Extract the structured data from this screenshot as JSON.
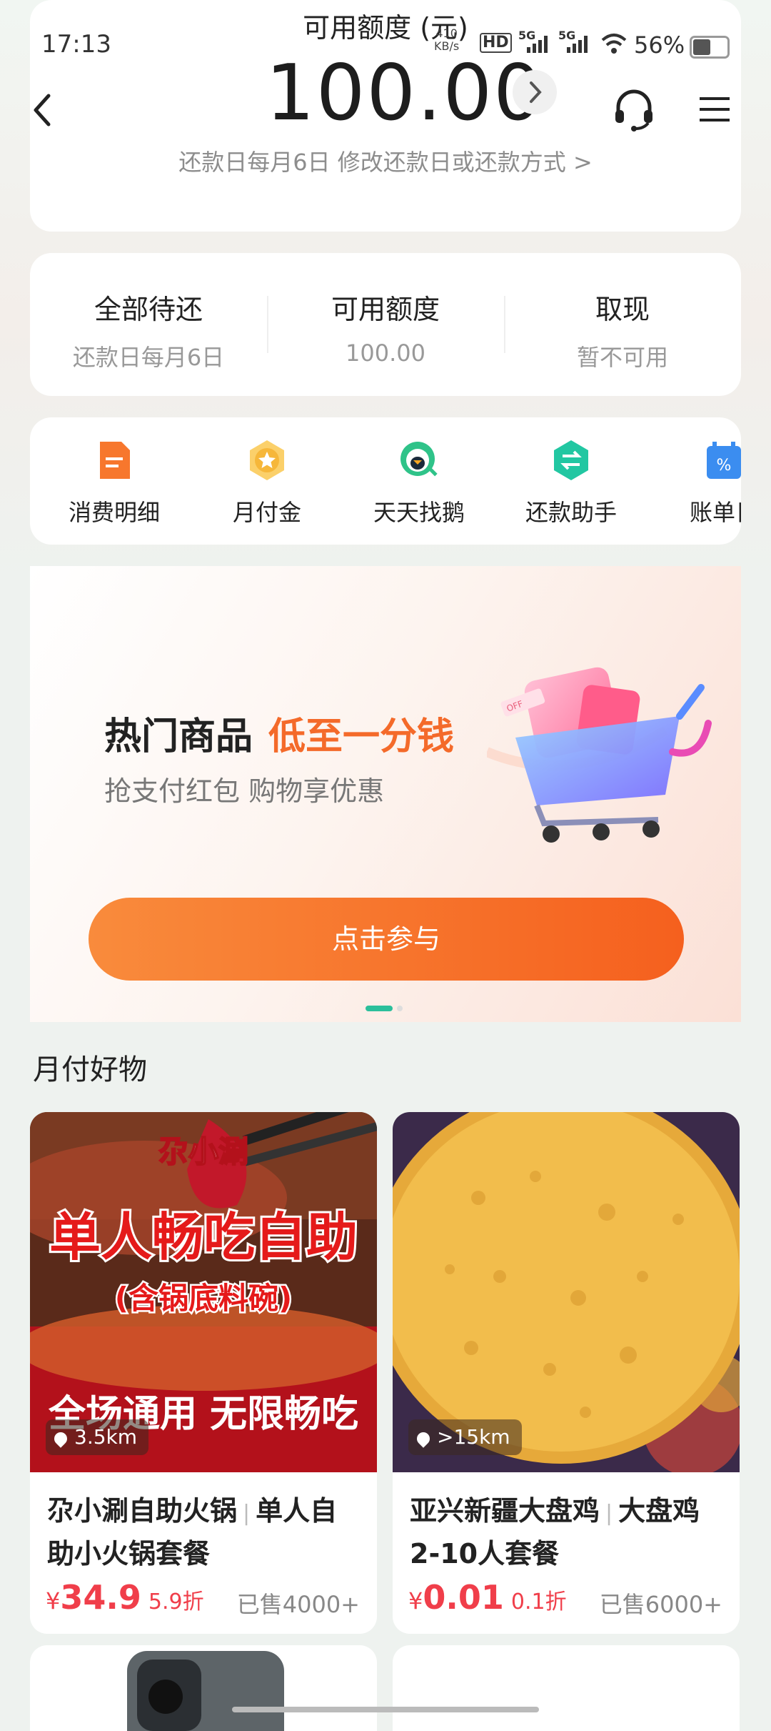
{
  "status_bar": {
    "time": "17:13",
    "net_speed_value": "410",
    "net_speed_unit": "KB/s",
    "hd_label": "HD",
    "net1": "5G",
    "net2": "5G",
    "battery": "56%"
  },
  "header": {
    "available_label": "可用额度 (元)",
    "amount": "100.00",
    "repay_info": "还款日每月6日 修改还款日或还款方式 >"
  },
  "summary": [
    {
      "title": "全部待还",
      "value": "还款日每月6日"
    },
    {
      "title": "可用额度",
      "value": "100.00"
    },
    {
      "title": "取现",
      "value": "暂不可用"
    }
  ],
  "quick_nav": [
    {
      "label": "消费明细",
      "icon": "bill-detail-icon",
      "color": "#f7772d"
    },
    {
      "label": "月付金",
      "icon": "star-coin-icon",
      "color": "#f6b73a"
    },
    {
      "label": "天天找鹅",
      "icon": "penguin-icon",
      "color": "#2fc389"
    },
    {
      "label": "还款助手",
      "icon": "repay-assistant-icon",
      "color": "#22c7a2"
    },
    {
      "label": "账单日",
      "icon": "calendar-icon",
      "color": "#3b8df0"
    }
  ],
  "banner": {
    "title": "热门商品",
    "highlight": "低至一分钱",
    "subtitle": "抢支付红包 购物享优惠",
    "button": "点击参与",
    "cart_tag": "OFF",
    "accent": "#f46a2a"
  },
  "section_title": "月付好物",
  "products": [
    {
      "name": "尕小涮自助火锅",
      "spec": "单人自助小火锅套餐",
      "distance": "3.5km",
      "currency": "¥",
      "price": "34.9",
      "discount": "5.9折",
      "sold": "已售4000+",
      "img_text": {
        "brand": "尕小涮",
        "main": "单人畅吃自助",
        "sub": "(含锅底料碗)",
        "bottom": "全场通用  无限畅吃"
      }
    },
    {
      "name": "亚兴新疆大盘鸡",
      "spec": "大盘鸡2-10人套餐",
      "distance": ">15km",
      "currency": "¥",
      "price": "0.01",
      "discount": "0.1折",
      "sold": "已售6000+"
    }
  ]
}
